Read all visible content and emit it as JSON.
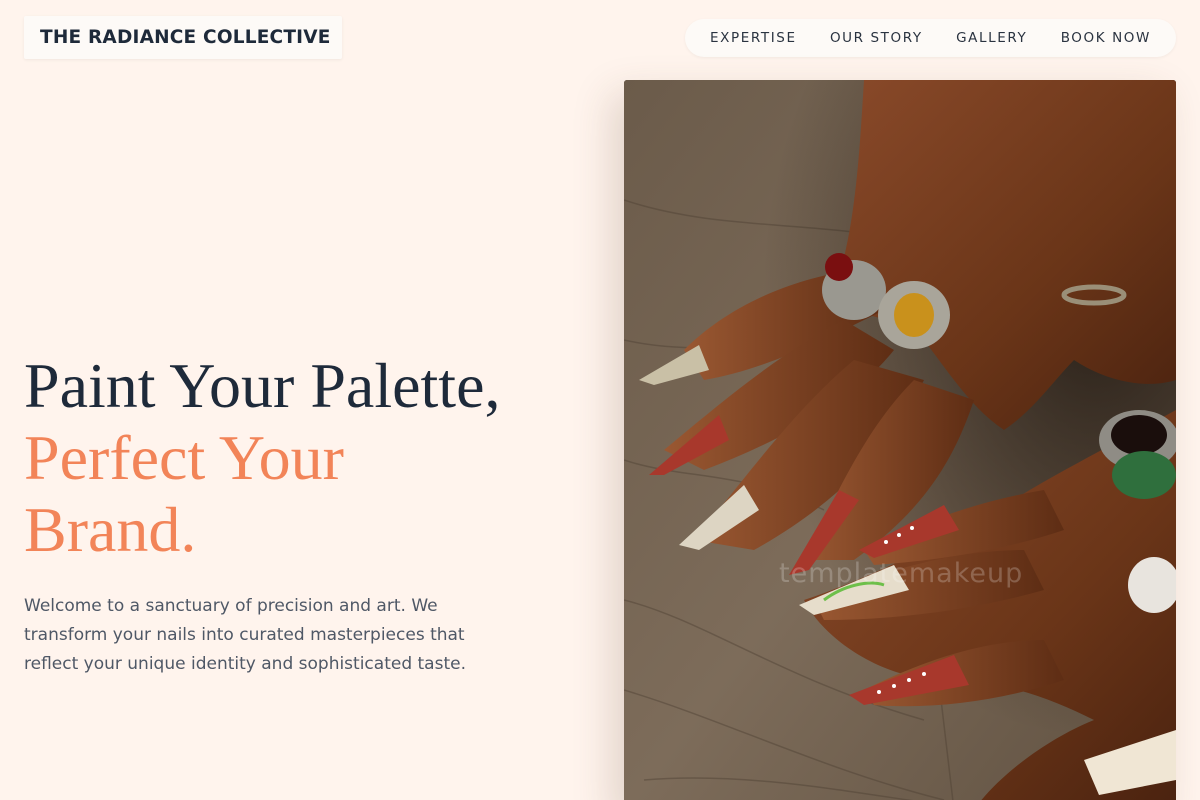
{
  "header": {
    "brand": "THE RADIANCE COLLECTIVE"
  },
  "nav": {
    "items": [
      {
        "label": "EXPERTISE"
      },
      {
        "label": "OUR STORY"
      },
      {
        "label": "GALLERY"
      },
      {
        "label": "BOOK NOW"
      }
    ]
  },
  "hero": {
    "headline_line1": "Paint Your Palette,",
    "headline_accent_line1": "Perfect Your",
    "headline_accent_line2": "Brand.",
    "description": "Welcome to a sanctuary of precision and art. We transform your nails into curated masterpieces that reflect your unique identity and sophisticated taste.",
    "image_watermark": "templatemakeup"
  },
  "colors": {
    "background": "#fff4ed",
    "ink": "#1e2a3a",
    "accent": "#f28458",
    "body_text": "#4f5866"
  }
}
